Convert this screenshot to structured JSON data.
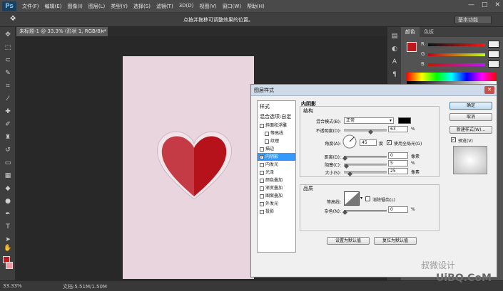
{
  "app": {
    "logo": "Ps",
    "menus": [
      "文件(F)",
      "编辑(E)",
      "图像(I)",
      "图层(L)",
      "类型(Y)",
      "选择(S)",
      "滤镜(T)",
      "3D(D)",
      "视图(V)",
      "窗口(W)",
      "帮助(H)"
    ],
    "window_controls": [
      "—",
      "□",
      "✕"
    ]
  },
  "options_bar": {
    "hint": "点按并拖移可调整效果的位置。",
    "workspace": "基本功能"
  },
  "document": {
    "tab_title": "未标题-1 @ 33.3% (形状 1, RGB/8) *",
    "zoom": "33.33%",
    "doc_size": "文档:5.51M/1.50M"
  },
  "right_panel": {
    "tabs": [
      "颜色",
      "色板"
    ],
    "sliders": [
      {
        "label": "R",
        "gradient": "linear-gradient(to right,#001616,#ff1616)"
      },
      {
        "label": "G",
        "gradient": "linear-gradient(to right,#c10016,#c1ff16)"
      },
      {
        "label": "B",
        "gradient": "linear-gradient(to right,#c11600,#c116ff)"
      }
    ]
  },
  "dialog": {
    "title": "图层样式",
    "styles_header": "样式",
    "blend_options": "混合选项:自定",
    "styles": [
      {
        "label": "斜面和浮雕",
        "checked": false,
        "sub": false
      },
      {
        "label": "等高线",
        "checked": false,
        "sub": true
      },
      {
        "label": "纹理",
        "checked": false,
        "sub": true
      },
      {
        "label": "描边",
        "checked": false,
        "sub": false
      },
      {
        "label": "内阴影",
        "checked": true,
        "sub": false,
        "active": true
      },
      {
        "label": "内发光",
        "checked": false,
        "sub": false
      },
      {
        "label": "光泽",
        "checked": false,
        "sub": false
      },
      {
        "label": "颜色叠加",
        "checked": false,
        "sub": false
      },
      {
        "label": "渐变叠加",
        "checked": false,
        "sub": false
      },
      {
        "label": "图案叠加",
        "checked": false,
        "sub": false
      },
      {
        "label": "外发光",
        "checked": false,
        "sub": false
      },
      {
        "label": "投影",
        "checked": false,
        "sub": false
      }
    ],
    "section_title": "内阴影",
    "structure_title": "结构",
    "blend_mode_label": "混合模式(B):",
    "blend_mode_value": "正常",
    "opacity_label": "不透明度(O):",
    "opacity_value": "63",
    "angle_label": "角度(A):",
    "angle_value": "45",
    "angle_unit": "度",
    "global_light_label": "使用全局光(G)",
    "distance_label": "距离(D):",
    "distance_value": "0",
    "choke_label": "阻塞(C):",
    "choke_value": "5",
    "size_label": "大小(S):",
    "size_value": "25",
    "quality_title": "品质",
    "contour_label": "等高线:",
    "antialias_label": "消除锯齿(L)",
    "noise_label": "杂色(N):",
    "noise_value": "0",
    "percent": "%",
    "pixels": "像素",
    "set_default": "设置为默认值",
    "reset_default": "复位为默认值",
    "ok": "确定",
    "cancel": "取消",
    "new_style": "新建样式(W)...",
    "preview": "预览(V)",
    "shadow_color": "#000000"
  },
  "watermark": {
    "text": "叔微设计",
    "site": "UiBQ.CoM"
  },
  "colors": {
    "foreground": "#c1161c",
    "background": "#ef9aa0",
    "canvas": "#e9d5dd",
    "heart_left": "#c43b45",
    "heart_right": "#b5121b"
  }
}
